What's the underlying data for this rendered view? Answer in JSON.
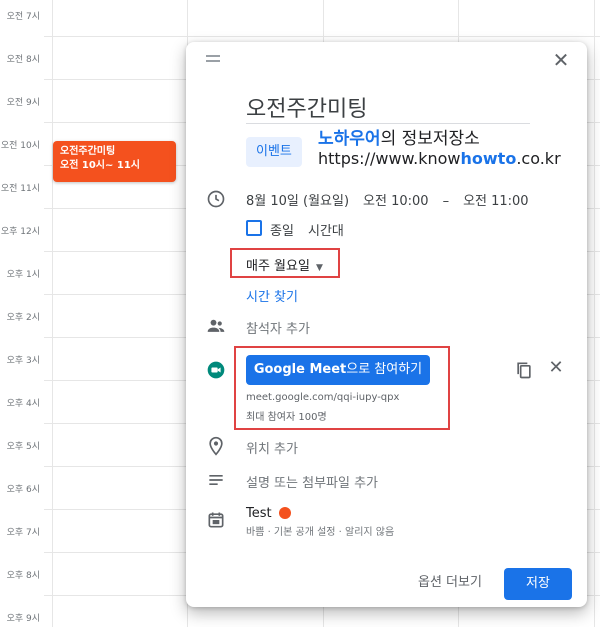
{
  "calendar": {
    "time_labels": [
      "오전 7시",
      "오전 8시",
      "오전 9시",
      "오전 10시",
      "오전 11시",
      "오후 12시",
      "오후 1시",
      "오후 2시",
      "오후 3시",
      "오후 4시",
      "오후 5시",
      "오후 6시",
      "오후 7시",
      "오후 8시",
      "오후 9시"
    ],
    "event": {
      "title": "오전주간미팅",
      "time": "오전 10시~ 11시",
      "color": "#f4511e"
    }
  },
  "dialog": {
    "close_icon": "close-icon",
    "title_value": "오전주간미팅",
    "tab_event": "이벤트",
    "watermark": {
      "brand": "노하우어",
      "suffix": "의 정보저장소",
      "url_prefix": "https://www.know",
      "url_highlight": "howto",
      "url_suffix": ".co.kr"
    },
    "date": "8월 10일 (월요일)",
    "start_time": "오전 10:00",
    "dash": "–",
    "end_time": "오전 11:00",
    "all_day_label": "종일",
    "timezone_label": "시간대",
    "recurrence": "매주 월요일",
    "find_time": "시간 찾기",
    "add_guests": "참석자 추가",
    "meet": {
      "button_strong": "Google Meet",
      "button_rest": "으로 참여하기",
      "url": "meet.google.com/qqi-iupy-qpx",
      "limit": "최대 참여자 100명"
    },
    "add_location": "위치 추가",
    "add_description": "설명 또는 첨부파일 추가",
    "calendar_name": "Test",
    "calendar_color": "#f4511e",
    "calendar_sub": "바쁨 · 기본 공개 설정 · 알리지 않음",
    "more_options": "옵션 더보기",
    "save": "저장"
  },
  "colors": {
    "accent": "#1a73e8",
    "highlight_border": "#e04343"
  }
}
